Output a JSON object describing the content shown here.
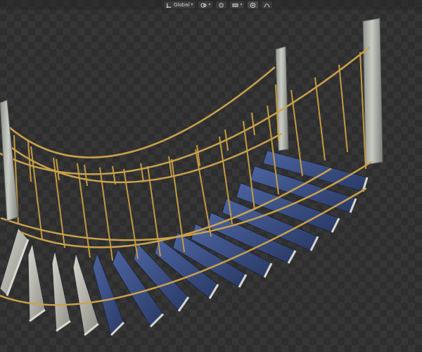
{
  "toolbar": {
    "orientation_label": "Global",
    "orientation_icon": "transform-orientation-icon",
    "pivot_icon": "pivot-point-icon",
    "snap_icon": "snap-magnet-icon",
    "snap_increment_icon": "snap-increment-icon",
    "proportional_icon": "proportional-editing-icon",
    "falloff_icon": "falloff-curve-icon"
  },
  "colors": {
    "viewport_bg": "#2e2e2e",
    "rope": "#c8a14a",
    "plank_blue": "#3c5286",
    "plank_grey": "#bfbfb8",
    "post": "#b8bcb4"
  }
}
